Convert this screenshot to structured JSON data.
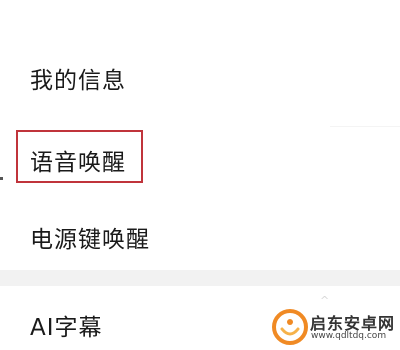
{
  "settings_list": {
    "items": [
      {
        "label": "我的信息"
      },
      {
        "label": "语音唤醒",
        "highlighted": true
      },
      {
        "label": "电源键唤醒"
      },
      {
        "label": "AI字幕"
      }
    ]
  },
  "annotation": {
    "highlight_color": "#c0343b"
  },
  "watermark": {
    "brand": "启东安卓网",
    "url": "www.qdltdq.com",
    "logo_icon": "orange-circle-logo-icon"
  }
}
